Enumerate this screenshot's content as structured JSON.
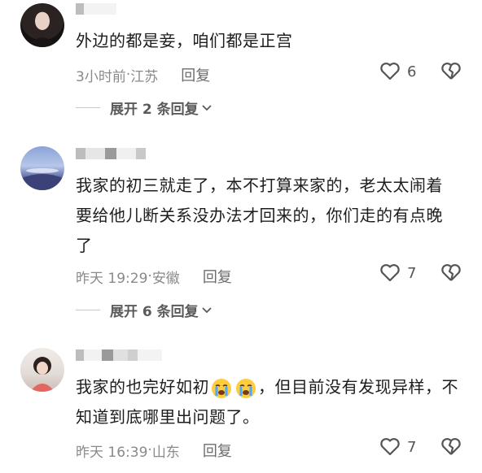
{
  "comments": [
    {
      "text": "外边的都是妾，咱们都是正宫",
      "time": "3小时前",
      "location": "江苏",
      "reply_label": "回复",
      "likes": "6",
      "expand_label": "展开 2 条回复"
    },
    {
      "text": "我家的初三就走了，本不打算来家的，老太太闹着要给他儿断关系没办法才回来的，你们走的有点晚了",
      "time": "昨天 19:29",
      "location": "安徽",
      "reply_label": "回复",
      "likes": "7",
      "expand_label": "展开 6 条回复"
    },
    {
      "text_before_emoji": "我家的也完好如初",
      "emoji_icons": [
        "crying-face-icon",
        "crying-face-icon"
      ],
      "text_after_emoji": "，但目前没有发现异样，不知道到底哪里出问题了。",
      "time": "昨天 16:39",
      "location": "山东",
      "reply_label": "回复",
      "likes": "7"
    }
  ],
  "separator": " · ",
  "colors": {
    "text": "#1d1d1d",
    "meta": "#8a8a8a",
    "icon": "#555555"
  }
}
